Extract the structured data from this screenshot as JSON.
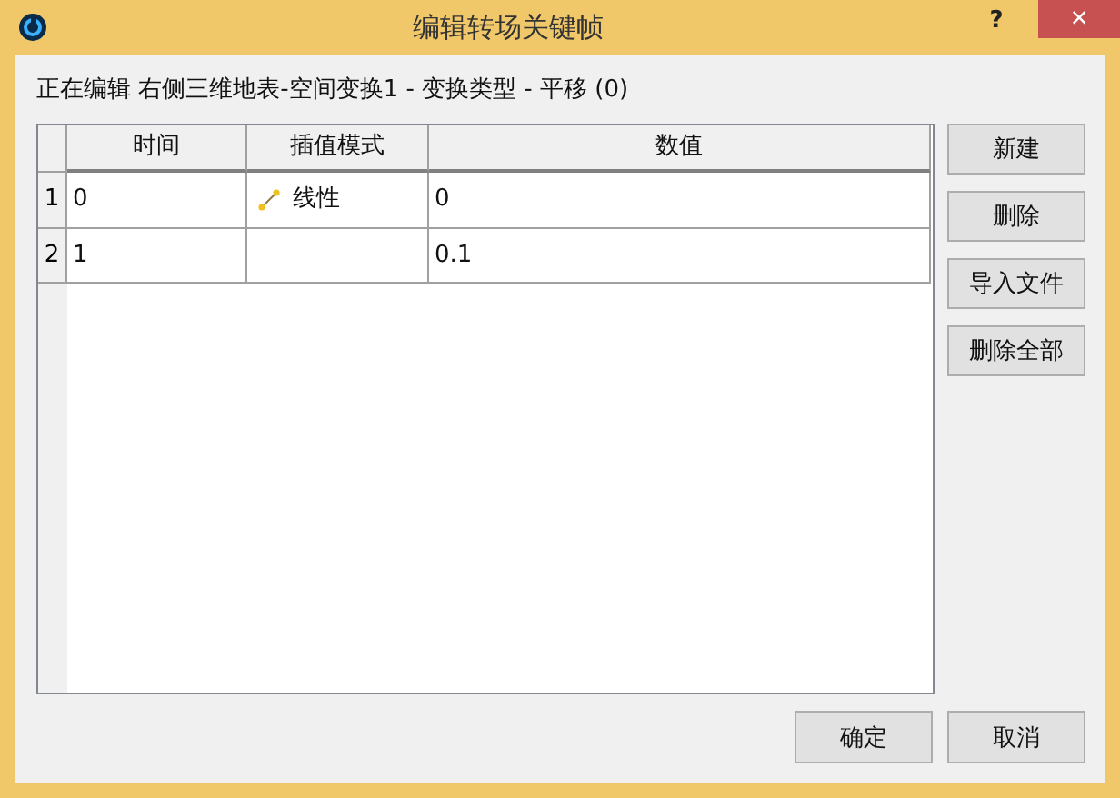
{
  "window": {
    "title": "编辑转场关键帧",
    "help": "?",
    "close": "×"
  },
  "editing_label": "正在编辑 右侧三维地表-空间变换1 - 变换类型 - 平移 (0)",
  "table": {
    "columns": [
      "时间",
      "插值模式",
      "数值"
    ],
    "rows": [
      {
        "number": "1",
        "time": "0",
        "interpolation": {
          "kind": "linear",
          "label": "线性"
        },
        "value": "0"
      },
      {
        "number": "2",
        "time": "1",
        "value": "0.1"
      }
    ]
  },
  "side_buttons": [
    "新建",
    "删除",
    "导入文件",
    "删除全部"
  ],
  "footer_buttons": [
    "确定",
    "取消"
  ]
}
